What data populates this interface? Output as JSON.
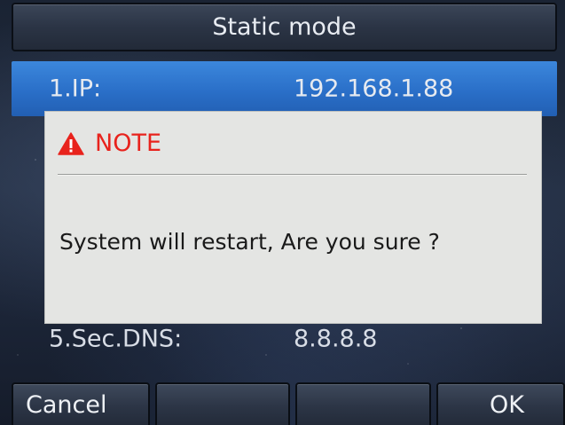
{
  "title": "Static mode",
  "rows": [
    {
      "label": "1.IP:",
      "value": "192.168.1.88"
    },
    {
      "label": "5.Sec.DNS:",
      "value": "8.8.8.8"
    }
  ],
  "dialog": {
    "icon": "warning-triangle-icon",
    "heading": "NOTE",
    "message": "System will restart, Are you sure ?",
    "heading_color": "#e8231d"
  },
  "softkeys": [
    "Cancel",
    "",
    "",
    "OK"
  ],
  "colors": {
    "selection": "#2a6fc8",
    "dialog_bg": "#e4e5e3"
  }
}
